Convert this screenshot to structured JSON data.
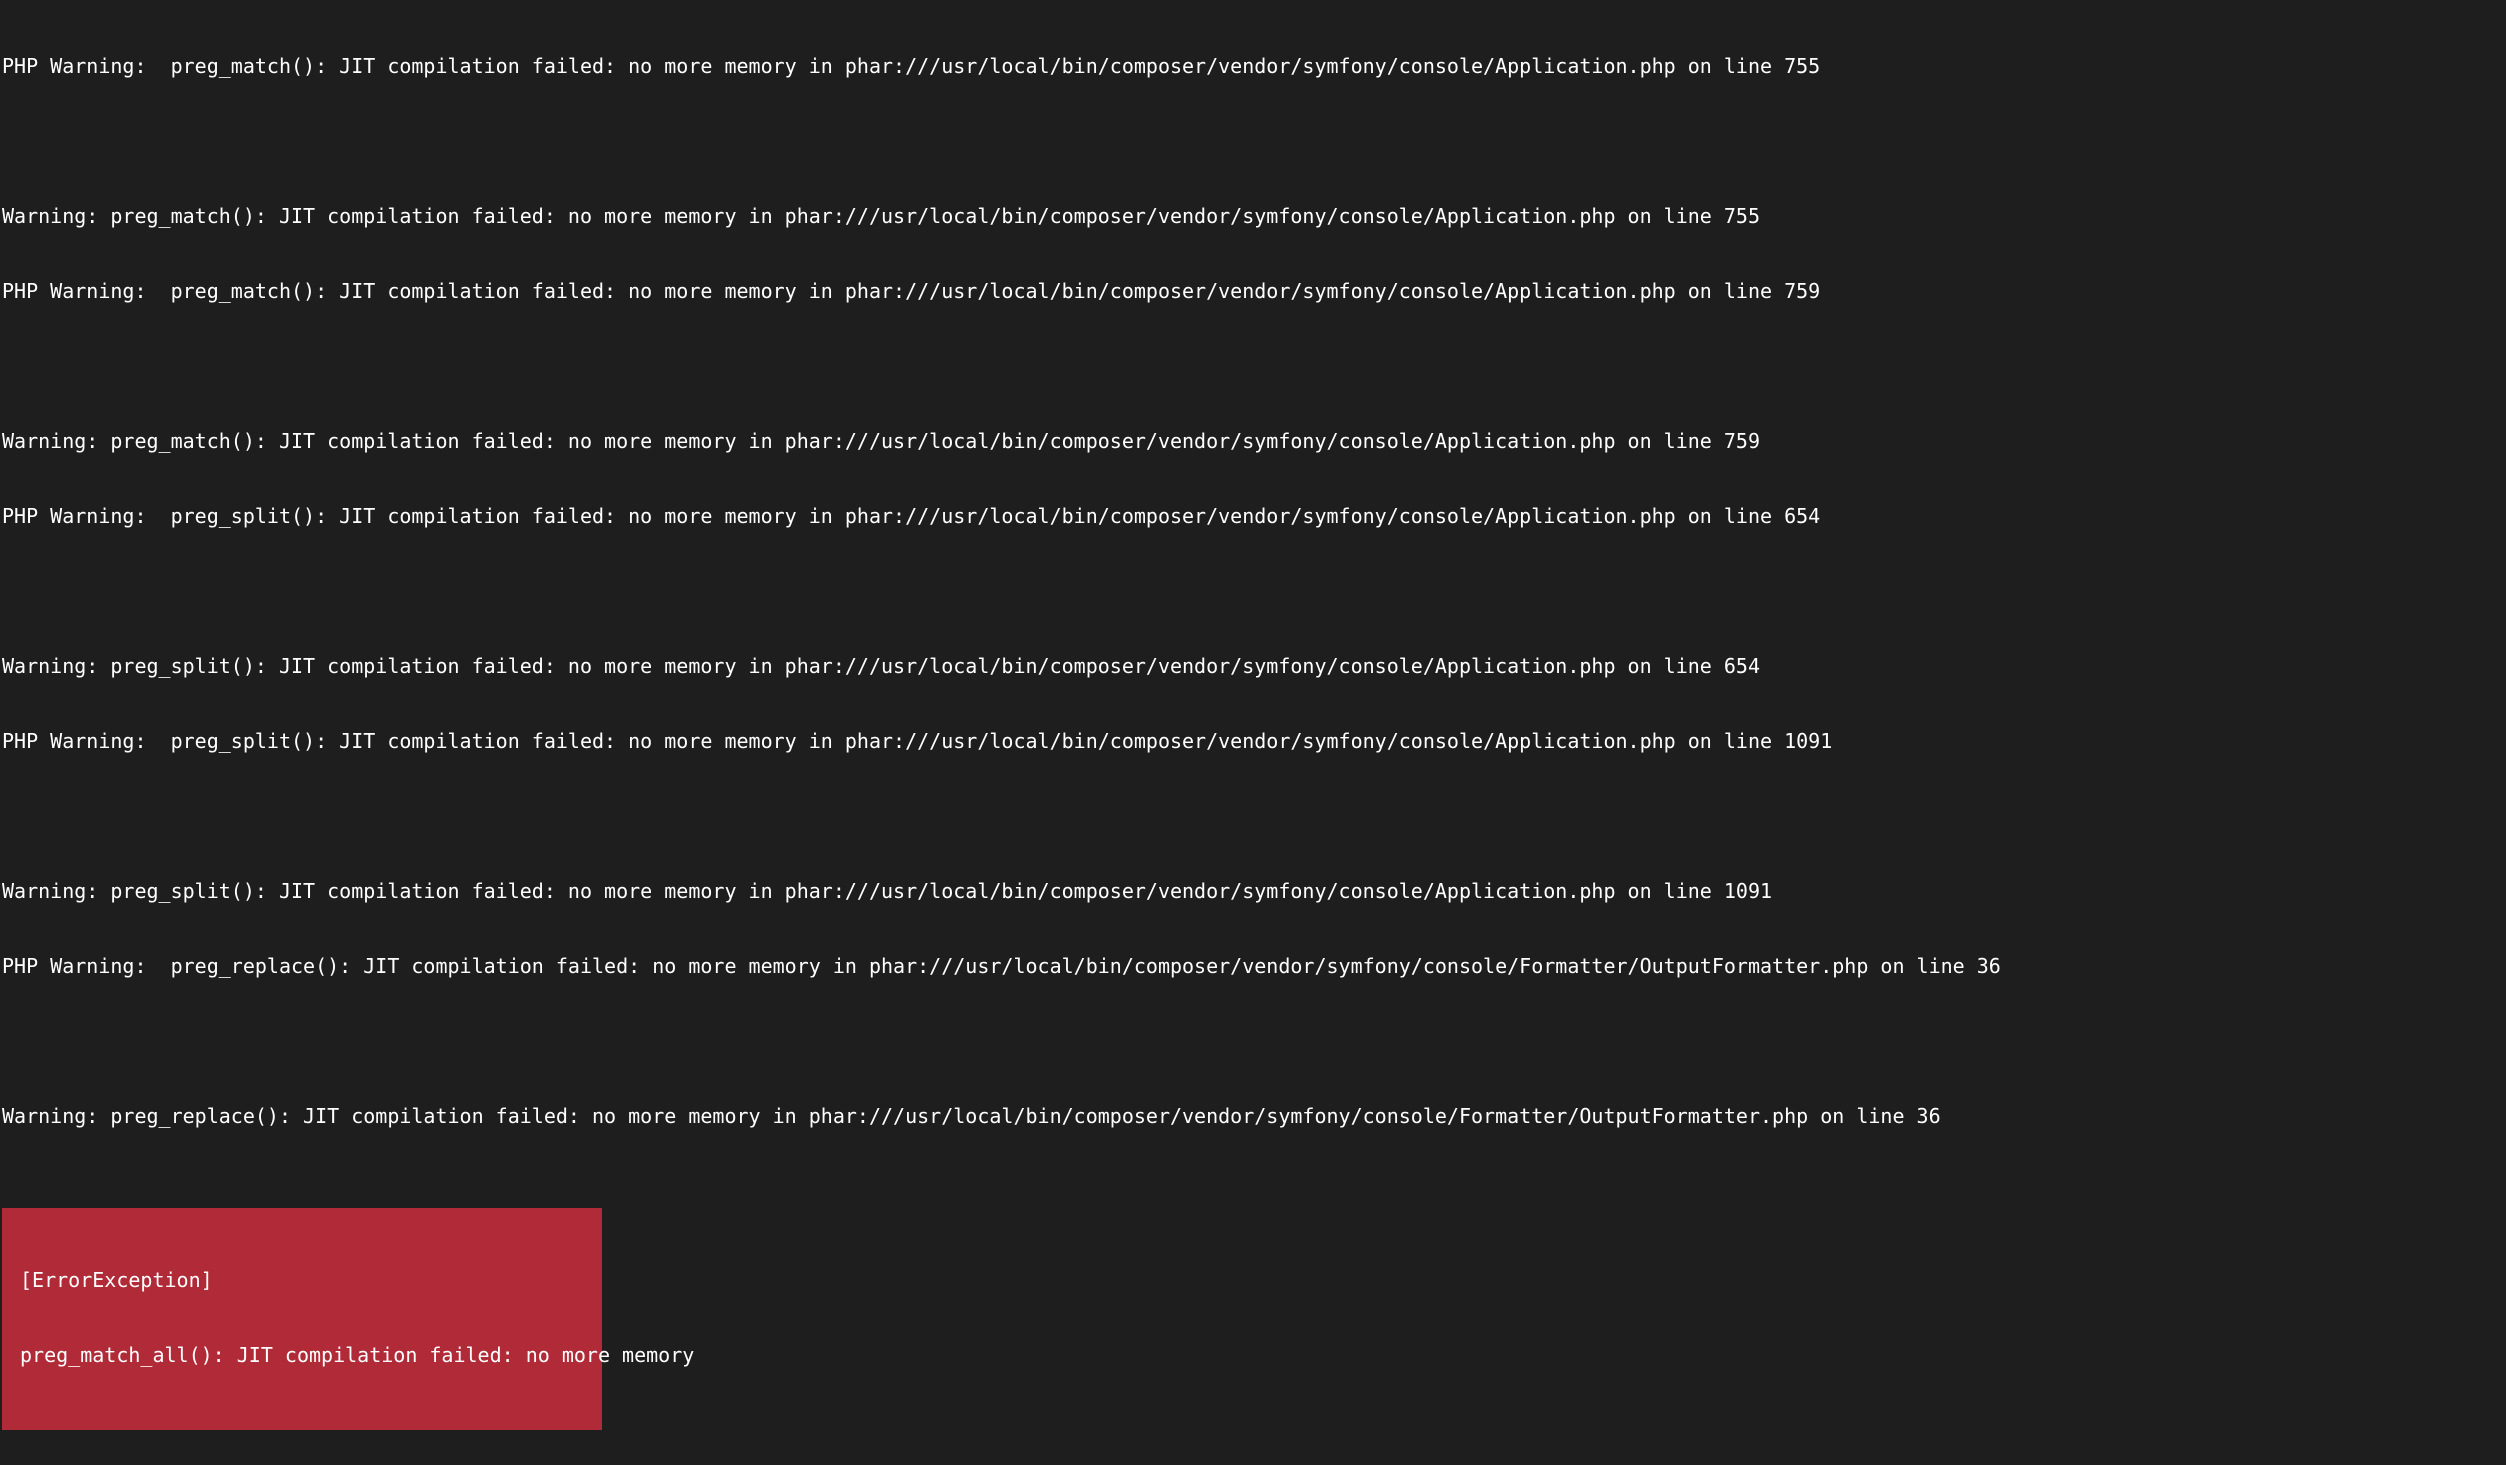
{
  "terminal_output": {
    "lines": [
      "PHP Warning:  preg_match(): JIT compilation failed: no more memory in phar:///usr/local/bin/composer/vendor/symfony/console/Application.php on line 755",
      "",
      "Warning: preg_match(): JIT compilation failed: no more memory in phar:///usr/local/bin/composer/vendor/symfony/console/Application.php on line 755",
      "PHP Warning:  preg_match(): JIT compilation failed: no more memory in phar:///usr/local/bin/composer/vendor/symfony/console/Application.php on line 759",
      "",
      "Warning: preg_match(): JIT compilation failed: no more memory in phar:///usr/local/bin/composer/vendor/symfony/console/Application.php on line 759",
      "PHP Warning:  preg_split(): JIT compilation failed: no more memory in phar:///usr/local/bin/composer/vendor/symfony/console/Application.php on line 654",
      "",
      "Warning: preg_split(): JIT compilation failed: no more memory in phar:///usr/local/bin/composer/vendor/symfony/console/Application.php on line 654",
      "PHP Warning:  preg_split(): JIT compilation failed: no more memory in phar:///usr/local/bin/composer/vendor/symfony/console/Application.php on line 1091",
      "",
      "Warning: preg_split(): JIT compilation failed: no more memory in phar:///usr/local/bin/composer/vendor/symfony/console/Application.php on line 1091",
      "PHP Warning:  preg_replace(): JIT compilation failed: no more memory in phar:///usr/local/bin/composer/vendor/symfony/console/Formatter/OutputFormatter.php on line 36",
      "",
      "Warning: preg_replace(): JIT compilation failed: no more memory in phar:///usr/local/bin/composer/vendor/symfony/console/Formatter/OutputFormatter.php on line 36"
    ]
  },
  "error_exception": {
    "title": "[ErrorException]",
    "message": "preg_match_all(): JIT compilation failed: no more memory"
  }
}
